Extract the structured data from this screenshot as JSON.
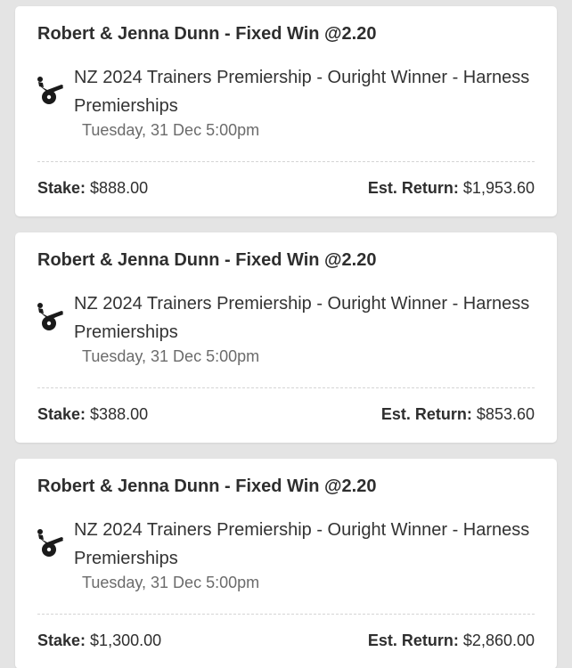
{
  "bets": [
    {
      "title": "Robert & Jenna Dunn - Fixed Win @2.20",
      "event_icon": "harness-racing-icon",
      "event_name": "NZ 2024 Trainers Premiership - Ouright Winner - Harness Premierships",
      "event_time": "Tuesday, 31 Dec 5:00pm",
      "stake_label": "Stake:",
      "stake_value": "$888.00",
      "return_label": "Est. Return:",
      "return_value": "$1,953.60"
    },
    {
      "title": "Robert & Jenna Dunn - Fixed Win @2.20",
      "event_icon": "harness-racing-icon",
      "event_name": "NZ 2024 Trainers Premiership - Ouright Winner - Harness Premierships",
      "event_time": "Tuesday, 31 Dec 5:00pm",
      "stake_label": "Stake:",
      "stake_value": "$388.00",
      "return_label": "Est. Return:",
      "return_value": "$853.60"
    },
    {
      "title": "Robert & Jenna Dunn - Fixed Win @2.20",
      "event_icon": "harness-racing-icon",
      "event_name": "NZ 2024 Trainers Premiership - Ouright Winner - Harness Premierships",
      "event_time": "Tuesday, 31 Dec 5:00pm",
      "stake_label": "Stake:",
      "stake_value": "$1,300.00",
      "return_label": "Est. Return:",
      "return_value": "$2,860.00"
    }
  ]
}
